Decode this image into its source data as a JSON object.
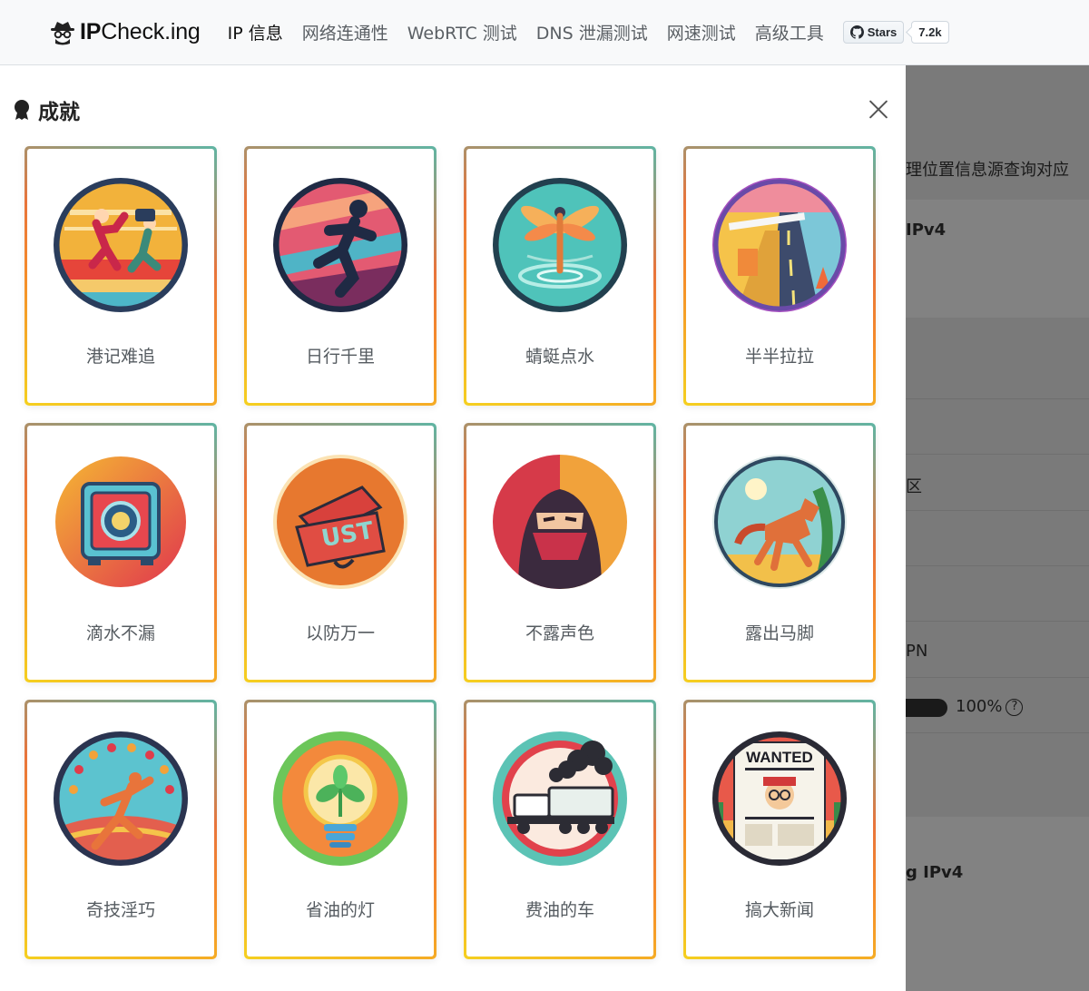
{
  "brand": {
    "name_bold": "IP",
    "name_rest": "Check.ing"
  },
  "nav": [
    {
      "label": "IP 信息",
      "active": true
    },
    {
      "label": "网络连通性"
    },
    {
      "label": "WebRTC 测试"
    },
    {
      "label": "DNS 泄漏测试"
    },
    {
      "label": "网速测试"
    },
    {
      "label": "高级工具"
    }
  ],
  "github": {
    "stars_label": "Stars",
    "count": "7.2k",
    "icon": "github-icon"
  },
  "modal": {
    "title": "成就",
    "title_icon": "trophy-icon",
    "close_icon": "close-icon",
    "achievements": [
      {
        "label": "港记难追",
        "icon": "runner-with-camera-icon"
      },
      {
        "label": "日行千里",
        "icon": "sprinting-figure-icon"
      },
      {
        "label": "蜻蜓点水",
        "icon": "dragonfly-icon"
      },
      {
        "label": "半半拉拉",
        "icon": "half-built-road-icon"
      },
      {
        "label": "滴水不漏",
        "icon": "safe-vault-icon"
      },
      {
        "label": "以防万一",
        "icon": "open-suitcase-icon"
      },
      {
        "label": "不露声色",
        "icon": "masked-ninja-icon"
      },
      {
        "label": "露出马脚",
        "icon": "horse-icon"
      },
      {
        "label": "奇技淫巧",
        "icon": "juggler-icon"
      },
      {
        "label": "省油的灯",
        "icon": "lightbulb-plant-icon"
      },
      {
        "label": "费油的车",
        "icon": "smoking-truck-icon"
      },
      {
        "label": "搞大新闻",
        "icon": "wanted-newspaper-icon"
      }
    ]
  },
  "background_page": {
    "source_query_fragment": "理位置信息源查询对应",
    "ipv4_heading_1": "IPv4",
    "region_fragment": "区",
    "vpn_fragment": "PN",
    "percent": "100%",
    "percent_help": "?",
    "ipv4_heading_2": "g IPv4"
  },
  "colors": {
    "accent_orange": "#e8743b",
    "accent_teal": "#5fb5a4",
    "accent_yellow": "#f5d020"
  }
}
